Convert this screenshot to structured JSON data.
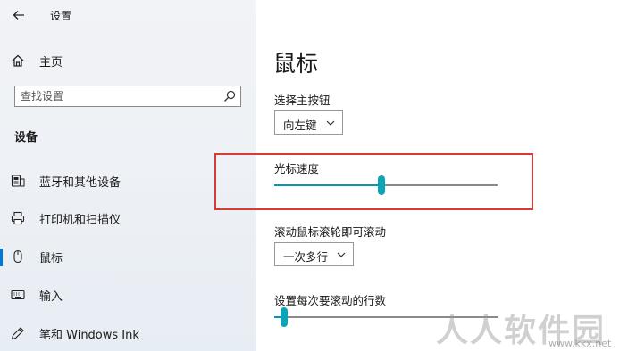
{
  "window": {
    "title": "设置",
    "back_icon": "arrow-left-icon"
  },
  "sidebar": {
    "home_label": "主页",
    "search_placeholder": "查找设置",
    "section_header": "设备",
    "items": [
      {
        "label": "蓝牙和其他设备",
        "icon": "bluetooth-devices-icon",
        "selected": false
      },
      {
        "label": "打印机和扫描仪",
        "icon": "printer-icon",
        "selected": false
      },
      {
        "label": "鼠标",
        "icon": "mouse-icon",
        "selected": true
      },
      {
        "label": "输入",
        "icon": "keyboard-icon",
        "selected": false
      },
      {
        "label": "笔和 Windows Ink",
        "icon": "pen-icon",
        "selected": false
      }
    ]
  },
  "main": {
    "title": "鼠标",
    "primary_button": {
      "label": "选择主按钮",
      "value": "向左键"
    },
    "cursor_speed": {
      "label": "光标速度",
      "value_fraction": 0.48
    },
    "scroll_mode": {
      "label": "滚动鼠标滚轮即可滚动",
      "value": "一次多行"
    },
    "scroll_lines": {
      "label": "设置每次要滚动的行数",
      "value_fraction": 0.03
    }
  },
  "watermark": {
    "text": "人人软件园",
    "url": "www.kkx.net"
  },
  "colors": {
    "accent": "#0078d7",
    "slider": "#0aa6b8",
    "highlight": "#d83a3a"
  }
}
